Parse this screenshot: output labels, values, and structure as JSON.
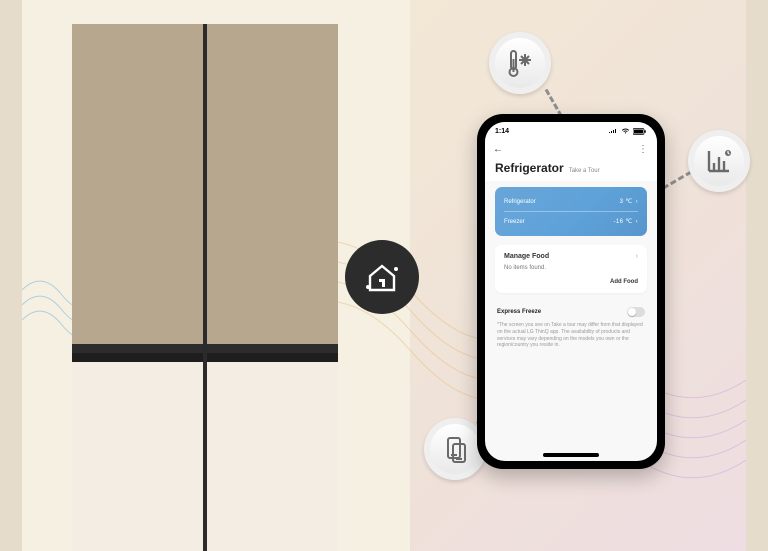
{
  "statusbar": {
    "time": "1:14"
  },
  "header": {
    "title": "Refrigerator",
    "tour": "Take a Tour"
  },
  "temp_card": {
    "fridge_label": "Refrigerator",
    "fridge_value": "3 ℃",
    "freezer_label": "Freezer",
    "freezer_value": "-16 ℃"
  },
  "food_card": {
    "title": "Manage Food",
    "empty": "No items found.",
    "action": "Add Food"
  },
  "toggle": {
    "label": "Express Freeze"
  },
  "fineprint": "*The screen you see on Take a tour may differ from that displayed on the actual LG ThinQ app. The availability of products and services may vary depending on the models you own or the region/country you reside in.",
  "icons": {
    "thinq": "thinq-home-icon",
    "temp": "thermometer-snowflake-icon",
    "chart": "bar-chart-icon",
    "diag": "smart-diagnosis-icon"
  }
}
